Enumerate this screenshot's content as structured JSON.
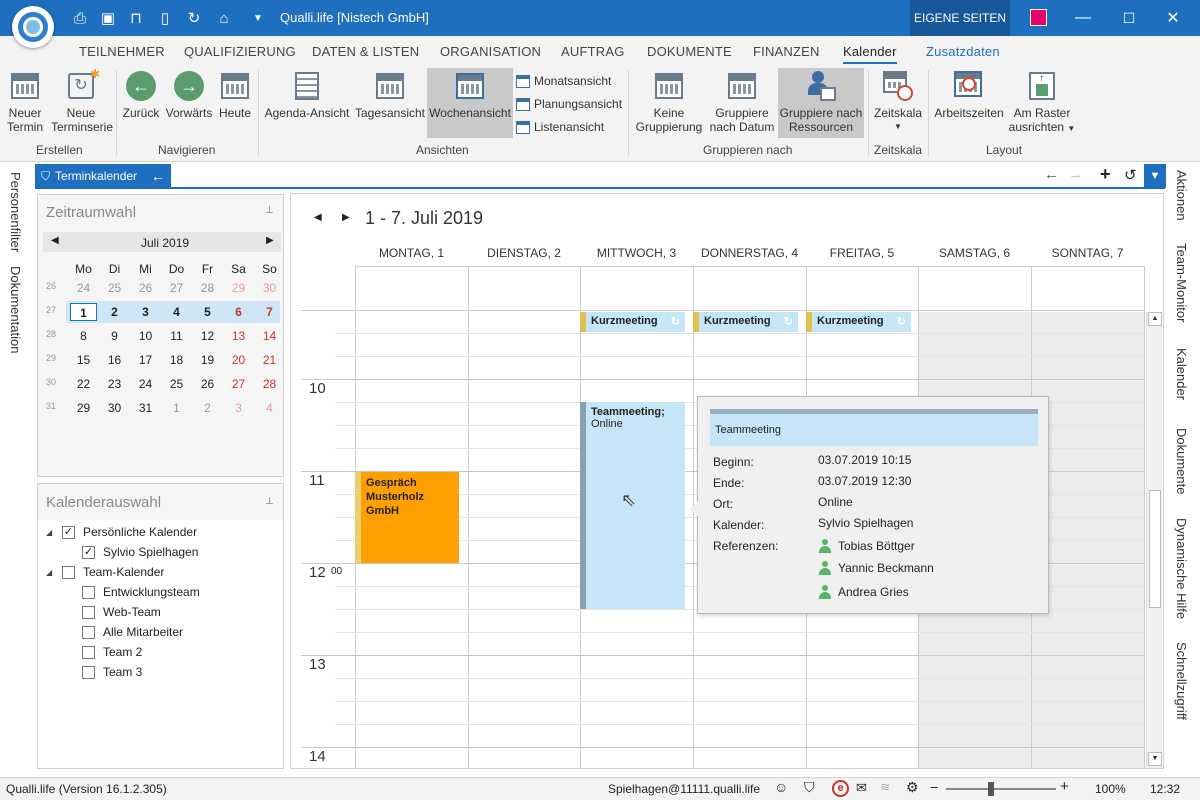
{
  "app": {
    "title": "Qualli.life [Nistech GmbH]",
    "eigene_seiten": "EIGENE SEITEN",
    "accent": "#1e6fbf",
    "swatch_color": "#e8006f"
  },
  "menu": {
    "tabs": [
      "TEILNEHMER",
      "QUALIFIZIERUNG",
      "DATEN & LISTEN",
      "ORGANISATION",
      "AUFTRAG",
      "DOKUMENTE",
      "FINANZEN",
      "Kalender",
      "Zusatzdaten"
    ],
    "active": "Kalender"
  },
  "ribbon": {
    "erstellen": {
      "label": "Erstellen",
      "neuer_termin": "Neuer Termin",
      "neue_terminserie": "Neue Terminserie"
    },
    "navigieren": {
      "label": "Navigieren",
      "zurueck": "Zurück",
      "vorwaerts": "Vorwärts",
      "heute": "Heute"
    },
    "ansichten": {
      "label": "Ansichten",
      "agenda": "Agenda-Ansicht",
      "tages": "Tagesansicht",
      "wochen": "Wochenansicht",
      "monats": "Monatsansicht",
      "planungs": "Planungsansicht",
      "listen": "Listenansicht"
    },
    "gruppieren": {
      "label": "Gruppieren nach",
      "keine": "Keine Gruppierung",
      "datum": "Gruppiere nach Datum",
      "ressourcen": "Gruppiere nach Ressourcen"
    },
    "zeitskala": {
      "label": "Zeitskala",
      "btn": "Zeitskala"
    },
    "layout": {
      "label": "Layout",
      "arbeitszeiten": "Arbeitszeiten",
      "raster": "Am Raster ausrichten"
    }
  },
  "left_strip": [
    "Personenfilter",
    "Dokumentation"
  ],
  "right_strip": [
    "Aktionen",
    "Team-Monitor",
    "Kalender",
    "Dokumente",
    "Dynamische Hilfe",
    "Schnellzugriff"
  ],
  "panel_tab": "Terminkalender",
  "zeitraumwahl": {
    "title": "Zeitraumwahl",
    "month": "Juli 2019",
    "weekdays": [
      "Mo",
      "Di",
      "Mi",
      "Do",
      "Fr",
      "Sa",
      "So"
    ],
    "weeks": [
      {
        "kw": "26",
        "days": [
          "24",
          "25",
          "26",
          "27",
          "28",
          "29",
          "30"
        ]
      },
      {
        "kw": "27",
        "days": [
          "1",
          "2",
          "3",
          "4",
          "5",
          "6",
          "7"
        ]
      },
      {
        "kw": "28",
        "days": [
          "8",
          "9",
          "10",
          "11",
          "12",
          "13",
          "14"
        ]
      },
      {
        "kw": "29",
        "days": [
          "15",
          "16",
          "17",
          "18",
          "19",
          "20",
          "21"
        ]
      },
      {
        "kw": "30",
        "days": [
          "22",
          "23",
          "24",
          "25",
          "26",
          "27",
          "28"
        ]
      },
      {
        "kw": "31",
        "days": [
          "29",
          "30",
          "31",
          "1",
          "2",
          "3",
          "4"
        ]
      }
    ]
  },
  "kalenderauswahl": {
    "title": "Kalenderauswahl",
    "items": [
      {
        "label": "Persönliche Kalender",
        "checked": true,
        "level": 0,
        "expander": true
      },
      {
        "label": "Sylvio Spielhagen",
        "checked": true,
        "level": 1,
        "expander": false
      },
      {
        "label": "Team-Kalender",
        "checked": false,
        "level": 0,
        "expander": true
      },
      {
        "label": "Entwicklungsteam",
        "checked": false,
        "level": 1,
        "expander": false
      },
      {
        "label": "Web-Team",
        "checked": false,
        "level": 1,
        "expander": false
      },
      {
        "label": "Alle Mitarbeiter",
        "checked": false,
        "level": 1,
        "expander": false
      },
      {
        "label": "Team 2",
        "checked": false,
        "level": 1,
        "expander": false
      },
      {
        "label": "Team 3",
        "checked": false,
        "level": 1,
        "expander": false
      }
    ]
  },
  "calendar": {
    "range": "1 - 7. Juli 2019",
    "days": [
      "MONTAG, 1",
      "DIENSTAG, 2",
      "MITTWOCH, 3",
      "DONNERSTAG, 4",
      "FREITAG, 5",
      "SAMSTAG, 6",
      "SONNTAG, 7"
    ],
    "hours": [
      "10",
      "11",
      "12",
      "13",
      "14"
    ],
    "noon_minutes": "00",
    "kurzmeeting": "Kurzmeeting",
    "gespraech": "Gespräch Musterholz GmbH",
    "teammeeting_title": "Teammeeting;",
    "teammeeting_loc": "Online"
  },
  "tooltip": {
    "title": "Teammeeting",
    "rows": [
      {
        "k": "Beginn:",
        "v": "03.07.2019 10:15"
      },
      {
        "k": "Ende:",
        "v": "03.07.2019 12:30"
      },
      {
        "k": "Ort:",
        "v": "Online"
      },
      {
        "k": "Kalender:",
        "v": "Sylvio Spielhagen"
      },
      {
        "k": "Referenzen:",
        "v": "Tobias Böttger"
      }
    ],
    "extra_refs": [
      "Yannic Beckmann",
      "Andrea Gries"
    ]
  },
  "status": {
    "version": "Qualli.life (Version 16.1.2.305)",
    "user": "Spielhagen@11111.qualli.life",
    "zoom": "100%",
    "time": "12:32"
  }
}
